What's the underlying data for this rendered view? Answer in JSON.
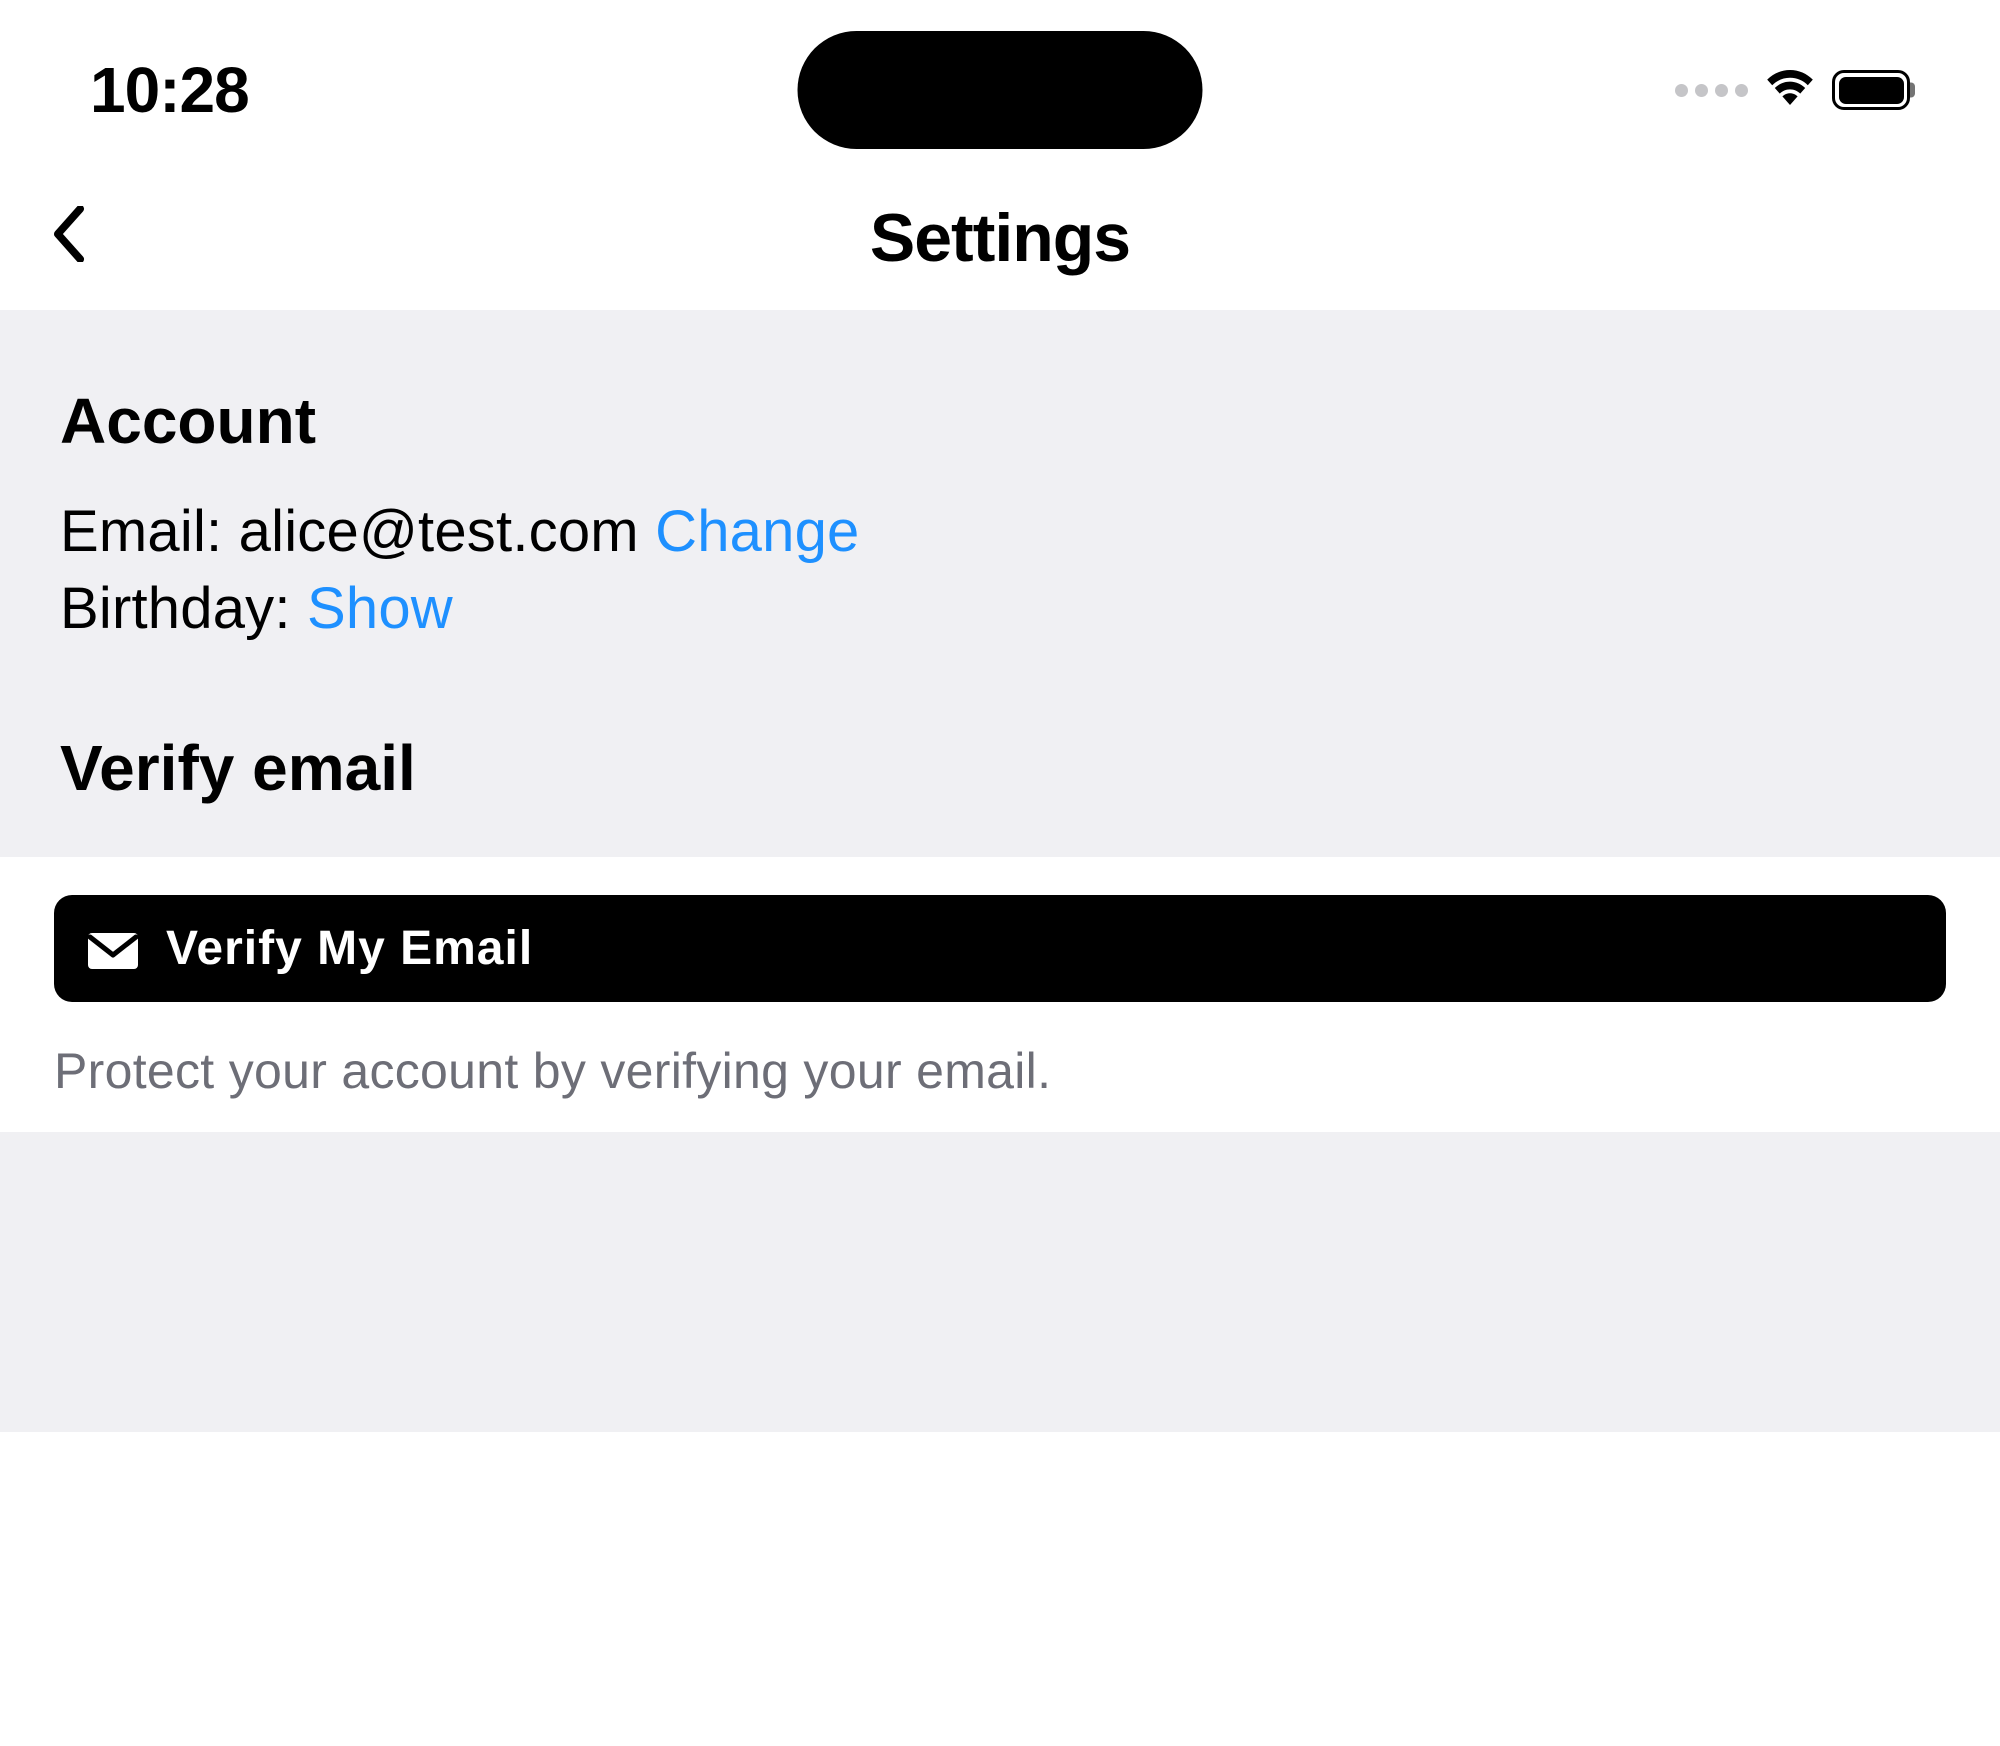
{
  "status": {
    "time": "10:28"
  },
  "nav": {
    "title": "Settings"
  },
  "account": {
    "heading": "Account",
    "email_label": "Email: ",
    "email_value": "alice@test.com",
    "change_link": "Change",
    "birthday_label": "Birthday: ",
    "show_link": "Show"
  },
  "verify": {
    "heading": "Verify email",
    "button_label": "Verify My Email",
    "hint": "Protect your account by verifying your email."
  }
}
